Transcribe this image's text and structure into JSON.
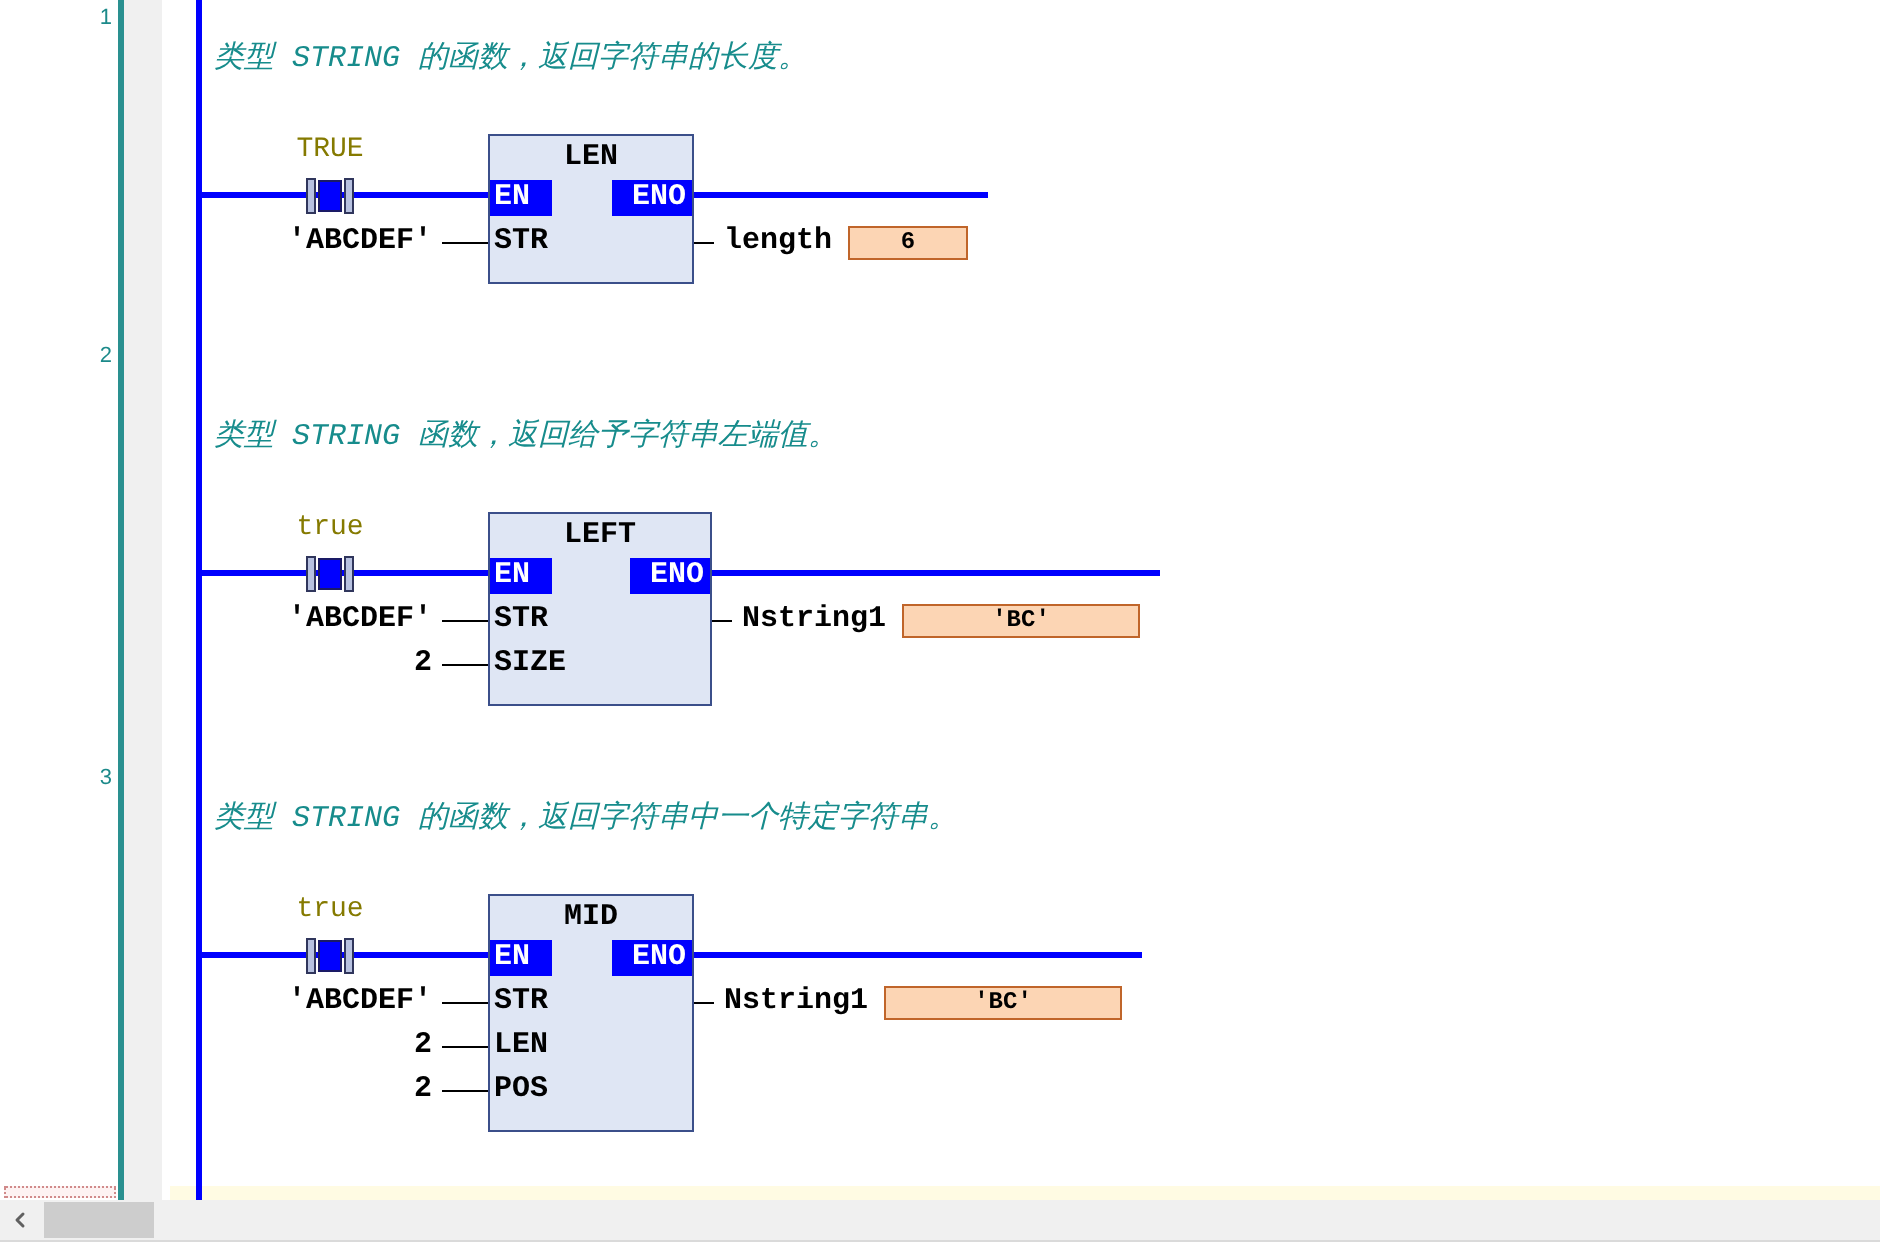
{
  "networks": [
    {
      "number": "1",
      "comment": "类型 STRING 的函数，返回字符串的长度。",
      "contact": {
        "label": "TRUE",
        "closed": true
      },
      "block": {
        "title": "LEN",
        "en": "EN",
        "eno": "ENO",
        "inputs": [
          {
            "pin": "STR",
            "value": "'ABCDEF'"
          }
        ],
        "output": {
          "variable": "length",
          "value": "6"
        }
      }
    },
    {
      "number": "2",
      "comment": "类型 STRING 函数，返回给予字符串左端值。",
      "contact": {
        "label": "true",
        "closed": true
      },
      "block": {
        "title": "LEFT",
        "en": "EN",
        "eno": "ENO",
        "inputs": [
          {
            "pin": "STR",
            "value": "'ABCDEF'"
          },
          {
            "pin": "SIZE",
            "value": "2"
          }
        ],
        "output": {
          "variable": "Nstring1",
          "value": "'BC'"
        }
      }
    },
    {
      "number": "3",
      "comment": "类型 STRING 的函数，返回字符串中一个特定字符串。",
      "contact": {
        "label": "true",
        "closed": true
      },
      "block": {
        "title": "MID",
        "en": "EN",
        "eno": "ENO",
        "inputs": [
          {
            "pin": "STR",
            "value": "'ABCDEF'"
          },
          {
            "pin": "LEN",
            "value": "2"
          },
          {
            "pin": "POS",
            "value": "2"
          }
        ],
        "output": {
          "variable": "Nstring1",
          "value": "'BC'"
        }
      }
    }
  ]
}
